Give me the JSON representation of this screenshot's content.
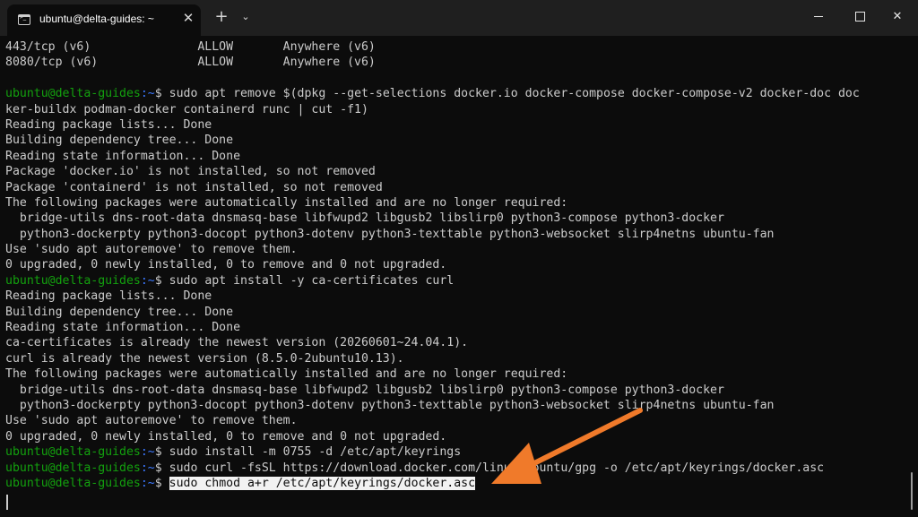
{
  "window": {
    "tab_title": "ubuntu@delta-guides: ~",
    "tab_close_icon": "close-icon",
    "new_tab_icon": "plus-icon",
    "dropdown_icon": "chevron-down-icon",
    "controls": [
      "minimize-icon",
      "maximize-icon",
      "close-icon"
    ],
    "tab_close_glyph": "✕",
    "new_tab_glyph": "+",
    "dropdown_glyph": "⌄",
    "close_glyph": "✕"
  },
  "terminal": {
    "prompt": {
      "user": "ubuntu@delta-guides",
      "path": ":~",
      "symbol": "$ "
    },
    "lines": [
      {
        "type": "out",
        "text": "443/tcp (v6)               ALLOW       Anywhere (v6)"
      },
      {
        "type": "out",
        "text": "8080/tcp (v6)              ALLOW       Anywhere (v6)"
      },
      {
        "type": "out",
        "text": ""
      },
      {
        "type": "cmd",
        "text": "sudo apt remove $(dpkg --get-selections docker.io docker-compose docker-compose-v2 docker-doc doc"
      },
      {
        "type": "out",
        "text": "ker-buildx podman-docker containerd runc | cut -f1)"
      },
      {
        "type": "out",
        "text": "Reading package lists... Done"
      },
      {
        "type": "out",
        "text": "Building dependency tree... Done"
      },
      {
        "type": "out",
        "text": "Reading state information... Done"
      },
      {
        "type": "out",
        "text": "Package 'docker.io' is not installed, so not removed"
      },
      {
        "type": "out",
        "text": "Package 'containerd' is not installed, so not removed"
      },
      {
        "type": "out",
        "text": "The following packages were automatically installed and are no longer required:"
      },
      {
        "type": "out",
        "text": "  bridge-utils dns-root-data dnsmasq-base libfwupd2 libgusb2 libslirp0 python3-compose python3-docker"
      },
      {
        "type": "out",
        "text": "  python3-dockerpty python3-docopt python3-dotenv python3-texttable python3-websocket slirp4netns ubuntu-fan"
      },
      {
        "type": "out",
        "text": "Use 'sudo apt autoremove' to remove them."
      },
      {
        "type": "out",
        "text": "0 upgraded, 0 newly installed, 0 to remove and 0 not upgraded."
      },
      {
        "type": "cmd",
        "text": "sudo apt install -y ca-certificates curl"
      },
      {
        "type": "out",
        "text": "Reading package lists... Done"
      },
      {
        "type": "out",
        "text": "Building dependency tree... Done"
      },
      {
        "type": "out",
        "text": "Reading state information... Done"
      },
      {
        "type": "out",
        "text": "ca-certificates is already the newest version (20260601~24.04.1)."
      },
      {
        "type": "out",
        "text": "curl is already the newest version (8.5.0-2ubuntu10.13)."
      },
      {
        "type": "out",
        "text": "The following packages were automatically installed and are no longer required:"
      },
      {
        "type": "out",
        "text": "  bridge-utils dns-root-data dnsmasq-base libfwupd2 libgusb2 libslirp0 python3-compose python3-docker"
      },
      {
        "type": "out",
        "text": "  python3-dockerpty python3-docopt python3-dotenv python3-texttable python3-websocket slirp4netns ubuntu-fan"
      },
      {
        "type": "out",
        "text": "Use 'sudo apt autoremove' to remove them."
      },
      {
        "type": "out",
        "text": "0 upgraded, 0 newly installed, 0 to remove and 0 not upgraded."
      },
      {
        "type": "cmd",
        "text": "sudo install -m 0755 -d /etc/apt/keyrings"
      },
      {
        "type": "cmd",
        "text": "sudo curl -fsSL https://download.docker.com/linux/ubuntu/gpg -o /etc/apt/keyrings/docker.asc"
      },
      {
        "type": "cmd",
        "text": "sudo chmod a+r /etc/apt/keyrings/docker.asc",
        "highlight": true
      }
    ]
  },
  "annotation": {
    "icon": "arrow-icon",
    "color": "#f07a2a"
  },
  "colors": {
    "background": "#0c0c0c",
    "titlebar": "#1f1f1f",
    "text": "#cccccc",
    "prompt_user": "#13a10e",
    "prompt_path": "#3b78ff"
  }
}
